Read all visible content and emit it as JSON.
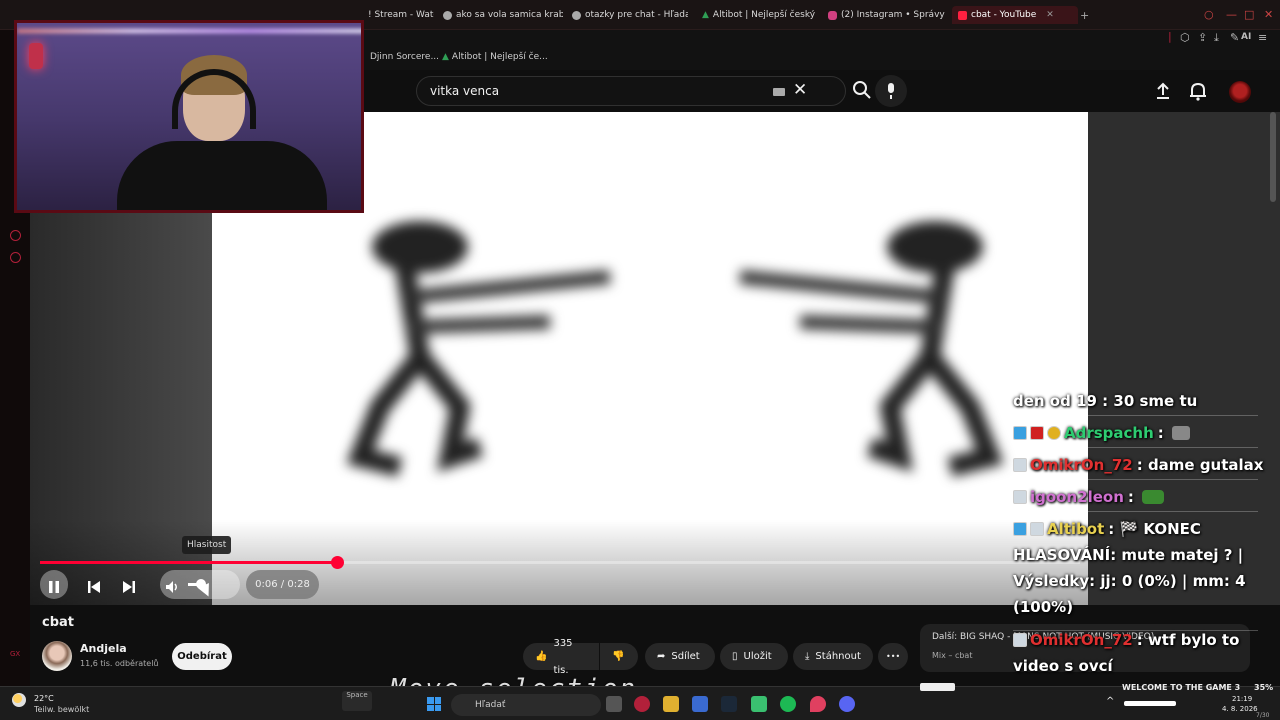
{
  "browser": {
    "tabs": [
      {
        "label": "! Stream - Watc"
      },
      {
        "label": "ako sa vola samica kraba"
      },
      {
        "label": "otazky pre chat - Hľadať G"
      },
      {
        "label": "Altibot | Nejlepší český Kic"
      },
      {
        "label": "(2) Instagram • Správy"
      },
      {
        "label": "cbat - YouTube"
      }
    ],
    "new_tab_symbol": "+",
    "bookmarks": [
      {
        "label": "Djinn Sorcere..."
      },
      {
        "label": "Altibot | Nejlepší če..."
      }
    ],
    "toolbar_label": "AI"
  },
  "search": {
    "query": "vitka venca",
    "clear_symbol": "✕"
  },
  "video": {
    "tooltip": "Hlasitost",
    "time": "0:06 / 0:28",
    "progress_fraction": 0.2857
  },
  "info": {
    "title": "cbat",
    "channel_name": "Andjela",
    "subscribers": "11,6 tis. odběratelů",
    "subscribe_label": "Odebírat",
    "like_count": "335 tis.",
    "share_label": "Sdílet",
    "save_label": "Uložit",
    "download_label": "Stáhnout",
    "more_symbol": "•••",
    "next_label": "Další: BIG SHAQ - MANS NOT HOT (MUSIC VIDEO)",
    "next_sub": "Mix – cbat"
  },
  "chat": [
    {
      "user": "",
      "user_color": "#ffffff",
      "message": "den od 19 : 30 sme tu"
    },
    {
      "user": "Adrspachh",
      "user_color": "#2ecc71",
      "message": ""
    },
    {
      "user": "OmikrOn_72",
      "user_color": "#e03030",
      "message": "dame gutalax"
    },
    {
      "user": "igoon2leon",
      "user_color": "#d070d0",
      "message": ""
    },
    {
      "user": "Altibot",
      "user_color": "#e8d050",
      "message": "🏁 KONEC HLASOVÁNÍ: mute matej ? | Výsledky: jj: 0 (0%) | mm: 4 (100%)"
    },
    {
      "user": "OmikrOn_72",
      "user_color": "#e03030",
      "message": "wtf bylo to video s ovcí"
    }
  ],
  "overlay": {
    "move_text": "Move selection",
    "spacebar_label": "Space"
  },
  "taskbar": {
    "temperature": "22°C",
    "weather_text": "Teilw. bewölkt",
    "search_label": "Hľadať",
    "game_label": "WELCOME TO THE GAME 3",
    "battery": "35%",
    "time": "21:19",
    "date": "4. 8. 2026",
    "page_counter": "7/30"
  },
  "colors": {
    "accent": "#ff0033",
    "page_bg": "#0f0f0f",
    "frame_red": "#5a0a14"
  }
}
